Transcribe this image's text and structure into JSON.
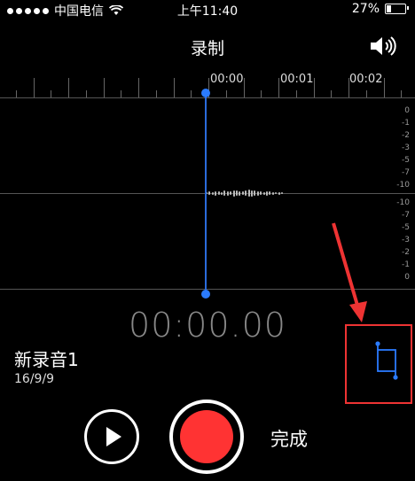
{
  "status_bar": {
    "carrier": "中国电信",
    "time": "上午11:40",
    "battery": "27%",
    "battery_level": 0.27
  },
  "title": "录制",
  "timeline": {
    "labels": [
      "00:00",
      "00:01",
      "00:02"
    ]
  },
  "db_scale": {
    "top": [
      "0",
      "-1",
      "-2",
      "-3",
      "-5",
      "-7",
      "-10"
    ],
    "bottom": [
      "-10",
      "-7",
      "-5",
      "-3",
      "-2",
      "-1",
      "0"
    ]
  },
  "timer": "00:00.00",
  "recording": {
    "name": "新录音1",
    "date": "16/9/9"
  },
  "controls": {
    "done_label": "完成"
  },
  "colors": {
    "accent": "#2a7bff",
    "record": "#ff3333",
    "highlight": "#e33333"
  }
}
